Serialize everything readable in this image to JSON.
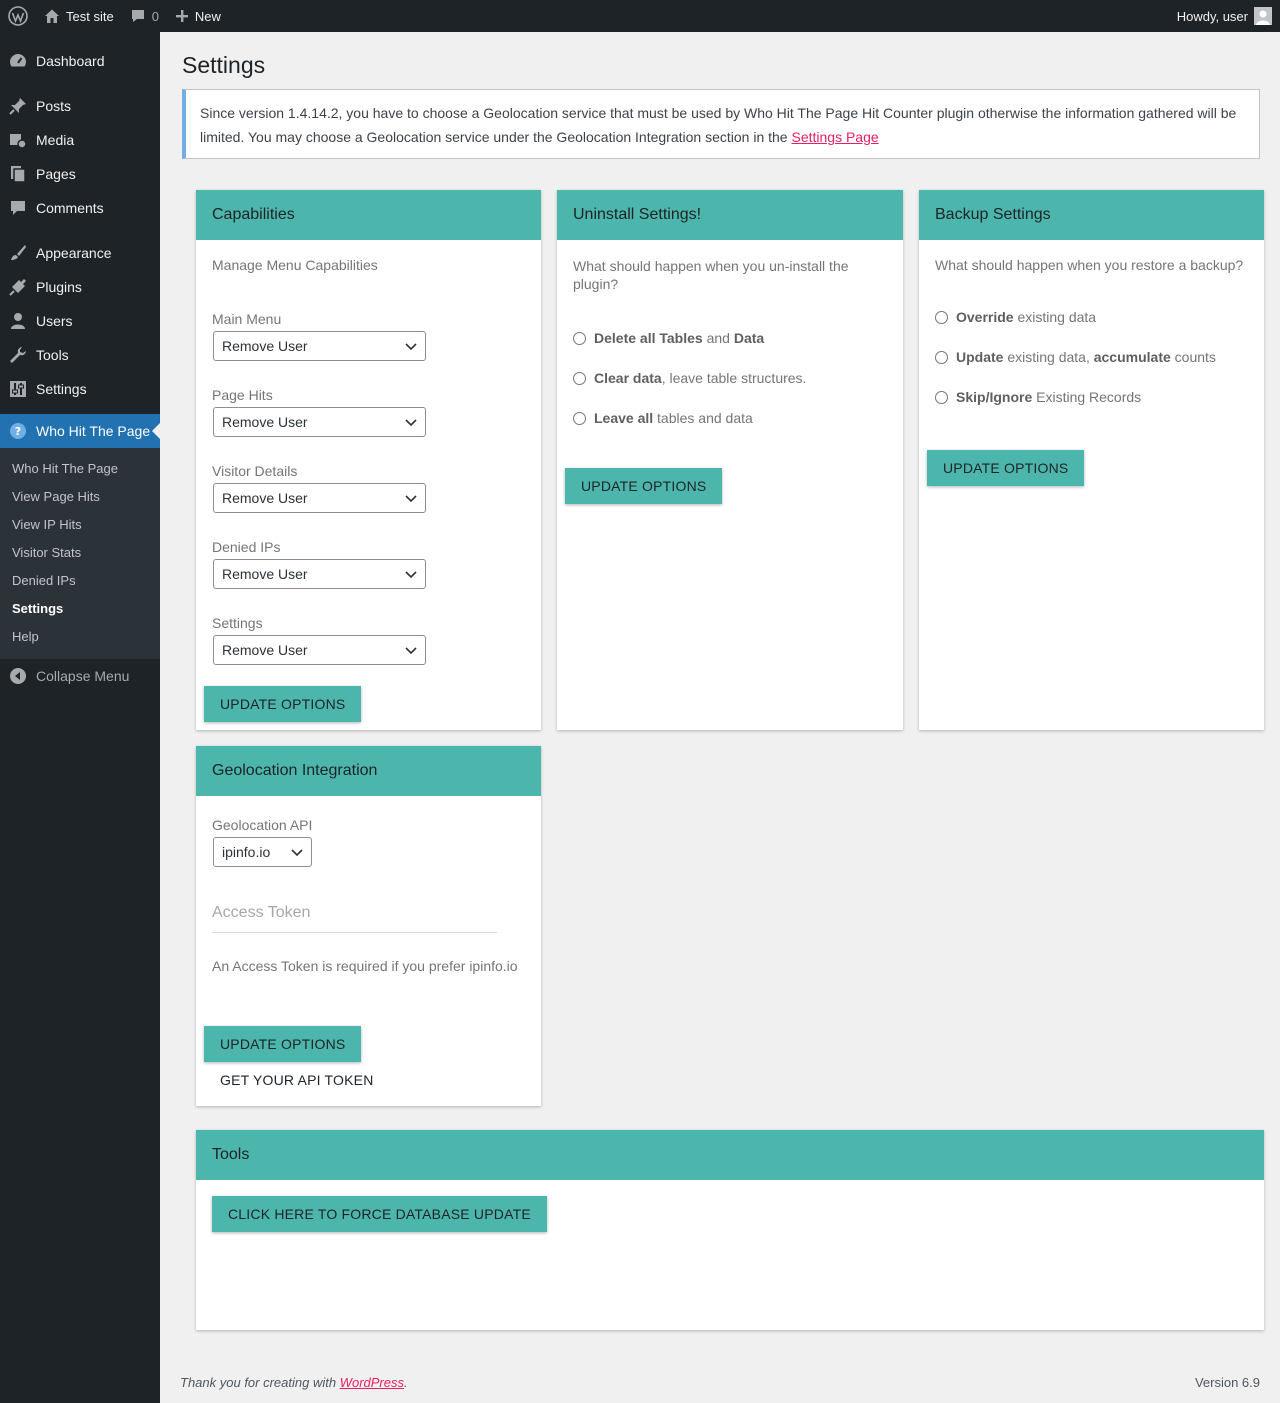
{
  "adminbar": {
    "site_name": "Test site",
    "comments_count": "0",
    "new_label": "New",
    "greeting": "Howdy, user"
  },
  "sidebar": {
    "items": [
      {
        "label": "Dashboard",
        "icon": "dashboard-icon"
      },
      {
        "label": "Posts",
        "icon": "pin-icon"
      },
      {
        "label": "Media",
        "icon": "media-icon"
      },
      {
        "label": "Pages",
        "icon": "pages-icon"
      },
      {
        "label": "Comments",
        "icon": "comment-icon"
      },
      {
        "label": "Appearance",
        "icon": "brush-icon"
      },
      {
        "label": "Plugins",
        "icon": "plug-icon"
      },
      {
        "label": "Users",
        "icon": "user-icon"
      },
      {
        "label": "Tools",
        "icon": "wrench-icon"
      },
      {
        "label": "Settings",
        "icon": "sliders-icon"
      },
      {
        "label": "Who Hit The Page",
        "icon": "help-icon"
      }
    ],
    "submenu": [
      "Who Hit The Page",
      "View Page Hits",
      "View IP Hits",
      "Visitor Stats",
      "Denied IPs",
      "Settings",
      "Help"
    ],
    "collapse_label": "Collapse Menu"
  },
  "page": {
    "title": "Settings",
    "notice_text": "Since version 1.4.14.2, you have to choose a Geolocation service that must be used by Who Hit The Page Hit Counter plugin otherwise the information gathered will be limited. You may choose a Geolocation service under the Geolocation Integration section in the",
    "notice_link": "Settings Page"
  },
  "capabilities": {
    "title": "Capabilities",
    "subtitle": "Manage Menu Capabilities",
    "fields": [
      {
        "label": "Main Menu",
        "value": "Remove User"
      },
      {
        "label": "Page Hits",
        "value": "Remove User"
      },
      {
        "label": "Visitor Details",
        "value": "Remove User"
      },
      {
        "label": "Denied IPs",
        "value": "Remove User"
      },
      {
        "label": "Settings",
        "value": "Remove User"
      }
    ],
    "button": "UPDATE OPTIONS"
  },
  "uninstall": {
    "title": "Uninstall Settings!",
    "question": "What should happen when you un-install the plugin?",
    "options": [
      {
        "b1": "Delete all Tables",
        "t1": " and ",
        "b2": "Data",
        "t2": ""
      },
      {
        "b1": "Clear data",
        "t1": ", leave table structures.",
        "b2": "",
        "t2": ""
      },
      {
        "b1": "Leave all",
        "t1": " tables and data",
        "b2": "",
        "t2": ""
      }
    ],
    "button": "UPDATE OPTIONS"
  },
  "backup": {
    "title": "Backup Settings",
    "question": "What should happen when you restore a backup?",
    "options": [
      {
        "b1": "Override",
        "t1": " existing data",
        "b2": "",
        "t2": ""
      },
      {
        "b1": "Update",
        "t1": " existing data, ",
        "b2": "accumulate",
        "t2": " counts"
      },
      {
        "b1": "Skip/Ignore",
        "t1": " Existing Records",
        "b2": "",
        "t2": ""
      }
    ],
    "button": "UPDATE OPTIONS"
  },
  "geolocation": {
    "title": "Geolocation Integration",
    "api_label": "Geolocation API",
    "api_value": "ipinfo.io",
    "token_placeholder": "Access Token",
    "helper": "An Access Token is required if you prefer ipinfo.io",
    "button": "UPDATE OPTIONS",
    "link_button": "GET YOUR API TOKEN"
  },
  "tools": {
    "title": "Tools",
    "button": "CLICK HERE TO FORCE DATABASE UPDATE"
  },
  "footer": {
    "text": "Thank you for creating with",
    "link": "WordPress",
    "period": ".",
    "version": "Version 6.9"
  },
  "colors": {
    "accent": "#4db6ac",
    "admin_dark": "#1d2327",
    "current_menu": "#2271b1",
    "link": "#e91e63"
  }
}
